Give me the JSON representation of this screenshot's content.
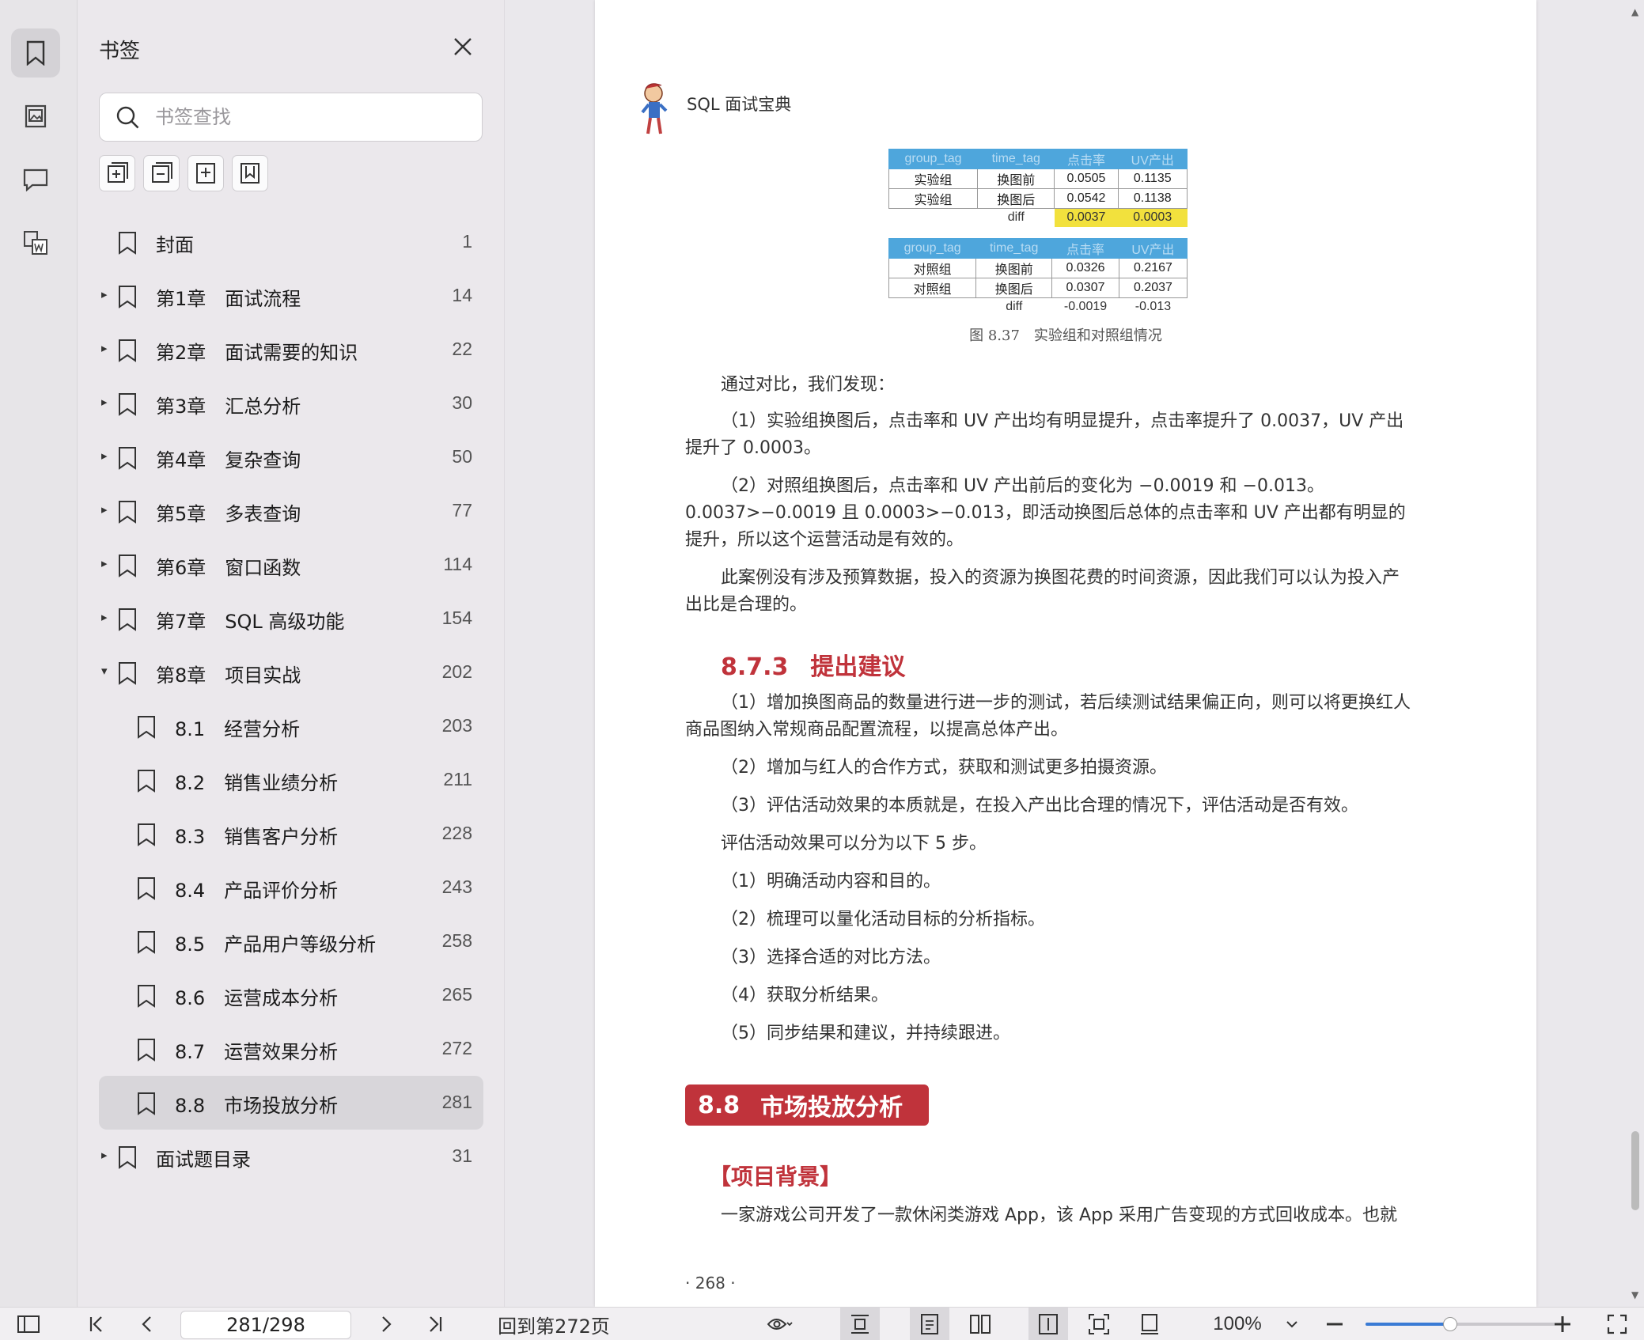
{
  "sidebar": {
    "title": "书签",
    "search_placeholder": "书签查找",
    "items": [
      {
        "title": "封面",
        "page": "1",
        "caret": ""
      },
      {
        "title": "第1章　面试流程",
        "page": "14",
        "caret": "▸"
      },
      {
        "title": "第2章　面试需要的知识",
        "page": "22",
        "caret": "▸"
      },
      {
        "title": "第3章　汇总分析",
        "page": "30",
        "caret": "▸"
      },
      {
        "title": "第4章　复杂查询",
        "page": "50",
        "caret": "▸"
      },
      {
        "title": "第5章　多表查询",
        "page": "77",
        "caret": "▸"
      },
      {
        "title": "第6章　窗口函数",
        "page": "114",
        "caret": "▸"
      },
      {
        "title": "第7章　SQL 高级功能",
        "page": "154",
        "caret": "▸"
      },
      {
        "title": "第8章　项目实战",
        "page": "202",
        "caret": "▾"
      },
      {
        "title": "8.1　经营分析",
        "page": "203",
        "caret": ""
      },
      {
        "title": "8.2　销售业绩分析",
        "page": "211",
        "caret": ""
      },
      {
        "title": "8.3　销售客户分析",
        "page": "228",
        "caret": ""
      },
      {
        "title": "8.4　产品评价分析",
        "page": "243",
        "caret": ""
      },
      {
        "title": "8.5　产品用户等级分析",
        "page": "258",
        "caret": ""
      },
      {
        "title": "8.6　运营成本分析",
        "page": "265",
        "caret": ""
      },
      {
        "title": "8.7　运营效果分析",
        "page": "272",
        "caret": ""
      },
      {
        "title": "8.8　市场投放分析",
        "page": "281",
        "caret": ""
      },
      {
        "title": "面试题目录",
        "page": "31",
        "caret": "▸"
      }
    ]
  },
  "document": {
    "header_text": "SQL 面试宝典",
    "table1": {
      "headers": [
        "group_tag",
        "time_tag",
        "点击率",
        "UV产出"
      ],
      "rows": [
        [
          "实验组",
          "换图前",
          "0.0505",
          "0.1135"
        ],
        [
          "实验组",
          "换图后",
          "0.0542",
          "0.1138"
        ]
      ],
      "diff": [
        "diff",
        "0.0037",
        "0.0003"
      ]
    },
    "table2": {
      "headers": [
        "group_tag",
        "time_tag",
        "点击率",
        "UV产出"
      ],
      "rows": [
        [
          "对照组",
          "换图前",
          "0.0326",
          "0.2167"
        ],
        [
          "对照组",
          "换图后",
          "0.0307",
          "0.2037"
        ]
      ],
      "diff": [
        "diff",
        "-0.0019",
        "-0.013"
      ]
    },
    "figure_caption": "图 8.37　实验组和对照组情况",
    "para_compare": "通过对比，我们发现：",
    "para_1": "（1）实验组换图后，点击率和 UV 产出均有明显提升，点击率提升了 0.0037，UV 产出提升了 0.0003。",
    "para_2": "（2）对照组换图后，点击率和 UV 产出前后的变化为 −0.0019 和 −0.013。0.0037>−0.0019 且 0.0003>−0.013，即活动换图后总体的点击率和 UV 产出都有明显的提升，所以这个运营活动是有效的。",
    "para_3": "此案例没有涉及预算数据，投入的资源为换图花费的时间资源，因此我们可以认为投入产出比是合理的。",
    "section_num": "8.7.3",
    "section_title": "提出建议",
    "sug_1": "（1）增加换图商品的数量进行进一步的测试，若后续测试结果偏正向，则可以将更换红人商品图纳入常规商品配置流程，以提高总体产出。",
    "sug_2": "（2）增加与红人的合作方式，获取和测试更多拍摄资源。",
    "sug_3": "（3）评估活动效果的本质就是，在投入产出比合理的情况下，评估活动是否有效。",
    "steps_intro": "评估活动效果可以分为以下 5 步。",
    "step_1": "（1）明确活动内容和目的。",
    "step_2": "（2）梳理可以量化活动目标的分析指标。",
    "step_3": "（3）选择合适的对比方法。",
    "step_4": "（4）获取分析结果。",
    "step_5": "（5）同步结果和建议，并持续跟进。",
    "chapter_num": "8.8",
    "chapter_title": "市场投放分析",
    "bg_heading": "【项目背景】",
    "bg_text": "一家游戏公司开发了一款休闲类游戏 App，该 App 采用广告变现的方式回收成本。也就",
    "page_number": "· 268 ·"
  },
  "bottombar": {
    "page_input": "281/298",
    "back_label": "回到第272页",
    "zoom": "100%"
  },
  "colors": {
    "accent_red": "#c0333b",
    "table_header": "#4ea6dc",
    "highlight": "#f2e13d"
  }
}
